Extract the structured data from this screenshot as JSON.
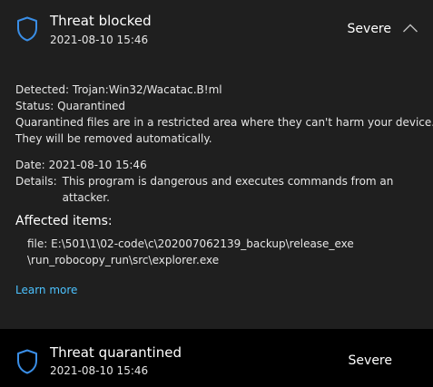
{
  "threats": [
    {
      "title": "Threat blocked",
      "timestamp": "2021-08-10 15:46",
      "severity": "Severe",
      "icon": "shield-icon",
      "details": {
        "detected_label": "Detected:",
        "detected_value": "Trojan:Win32/Wacatac.B!ml",
        "status_label": "Status:",
        "status_value": "Quarantined",
        "status_description_line1": "Quarantined files are in a restricted area where they can't harm your device.",
        "status_description_line2": "They will be removed automatically.",
        "date_label": "Date:",
        "date_value": "2021-08-10 15:46",
        "details_label": "Details:",
        "details_value_line1": "This program is dangerous and executes commands from an",
        "details_value_line2": "attacker."
      },
      "affected_items_title": "Affected items:",
      "affected_items_line1": "file: E:\\501\\1\\02-code\\c\\202007062139_backup\\release_exe",
      "affected_items_line2": "\\run_robocopy_run\\src\\explorer.exe",
      "learn_more": "Learn more",
      "collapse_icon": "chevron-up-icon"
    },
    {
      "title": "Threat quarantined",
      "timestamp": "2021-08-10 15:46",
      "severity": "Severe",
      "icon": "shield-icon"
    }
  ],
  "colors": {
    "accent": "#4cc2ff",
    "shield": "#3a8ee6",
    "expanded_bg": "#1f1f1f",
    "page_bg": "#000000"
  }
}
